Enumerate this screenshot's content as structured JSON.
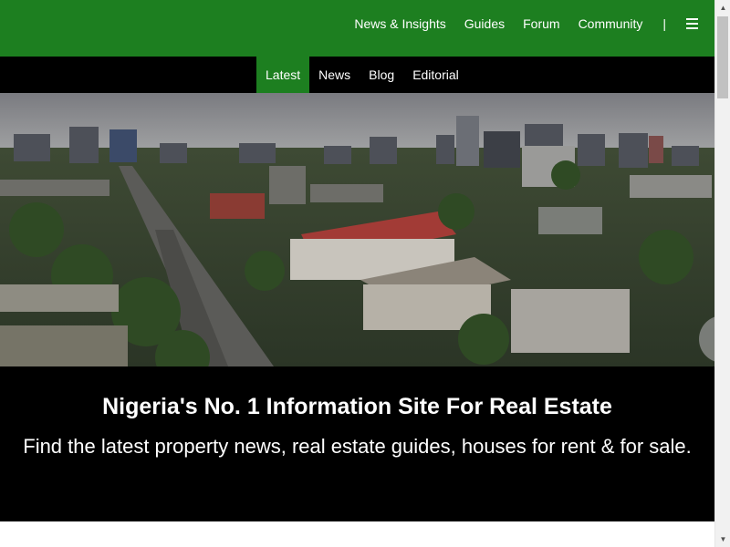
{
  "header": {
    "nav": [
      "News & Insights",
      "Guides",
      "Forum",
      "Community"
    ],
    "separator": "|",
    "menu_icon": "hamburger-icon",
    "bg_color": "#1d7f20"
  },
  "subnav": {
    "items": [
      "Latest",
      "News",
      "Blog",
      "Editorial"
    ],
    "active": "Latest",
    "active_color": "#1d7f20"
  },
  "hero": {
    "image": "aerial city skyline with red-roofed building and palm-lined road",
    "title": "Nigeria's No. 1 Information Site For Real Estate",
    "subtitle": "Find the latest property news, real estate guides, houses for rent & for sale."
  },
  "scrollbar": {
    "up_icon": "scroll-up-arrow-icon",
    "down_icon": "scroll-down-arrow-icon"
  }
}
